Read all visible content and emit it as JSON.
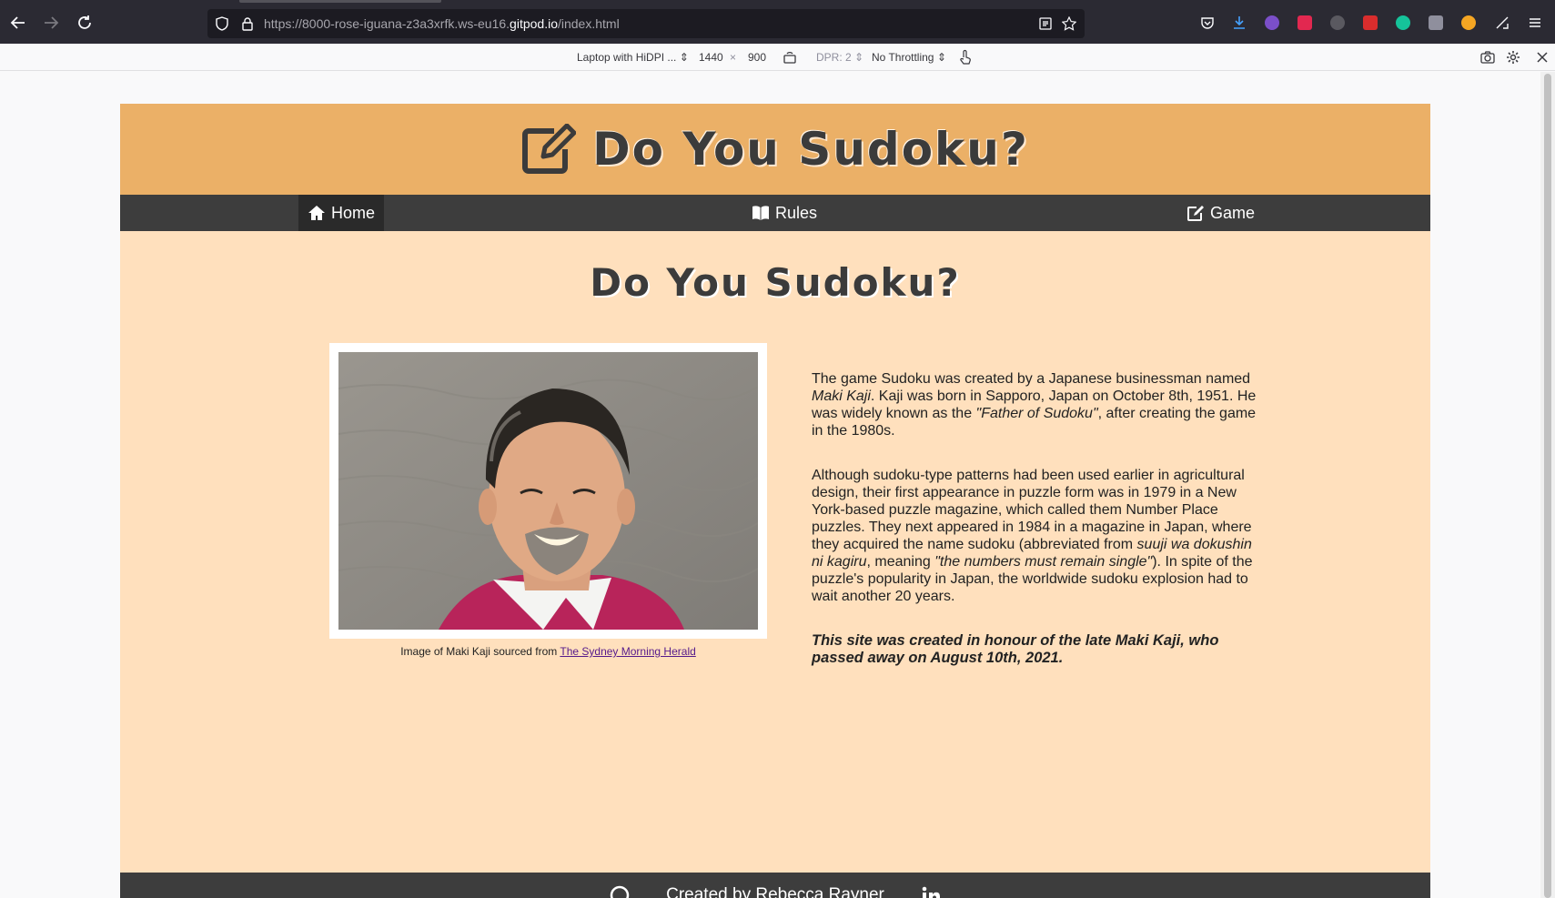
{
  "browser": {
    "url_prefix": "https://8000-rose-iguana-z3a3xrfk.ws-eu16.",
    "url_domain": "gitpod.io",
    "url_suffix": "/index.html"
  },
  "rdm": {
    "device": "Laptop with HiDPI ... ⇕",
    "width": "1440",
    "times": "×",
    "height": "900",
    "dpr": "DPR: 2 ⇕",
    "throttling": "No Throttling ⇕"
  },
  "site": {
    "title": "Do You Sudoku?",
    "nav": [
      {
        "label": "Home",
        "icon": "home-icon",
        "active": true
      },
      {
        "label": "Rules",
        "icon": "book-icon"
      },
      {
        "label": "Game",
        "icon": "edit-icon"
      }
    ],
    "heading": "Do You Sudoku?",
    "caption_text": "Image of Maki Kaji sourced from ",
    "caption_link": "The Sydney Morning Herald",
    "p1": {
      "a": "The game Sudoku was created by a Japanese businessman named ",
      "b": "Maki Kaji",
      "c": ". Kaji was born in Sapporo, Japan on October 8th, 1951. He was widely known as the ",
      "d": "\"Father of Sudoku\"",
      "e": ", after creating the game in the 1980s."
    },
    "p2": {
      "a": "Although sudoku-type patterns had been used earlier in agricultural design, their first appearance in puzzle form was in 1979 in a New York-based puzzle magazine, which called them Number Place puzzles. They next appeared in 1984 in a magazine in Japan, where they acquired the name sudoku (abbreviated from ",
      "b": "suuji wa dokushin ni kagiru",
      "c": ", meaning ",
      "d": "\"the numbers must remain single\"",
      "e": "). In spite of the puzzle's popularity in Japan, the worldwide sudoku explosion had to wait another 20 years."
    },
    "honour": "This site was created in honour of the late Maki Kaji, who passed away on August 10th, 2021.",
    "footer": "Created by Rebecca Rayner"
  },
  "colors": {
    "header_bg": "#ebb067",
    "page_bg": "#ffe0bd",
    "nav_bg": "#3d3d3d"
  }
}
